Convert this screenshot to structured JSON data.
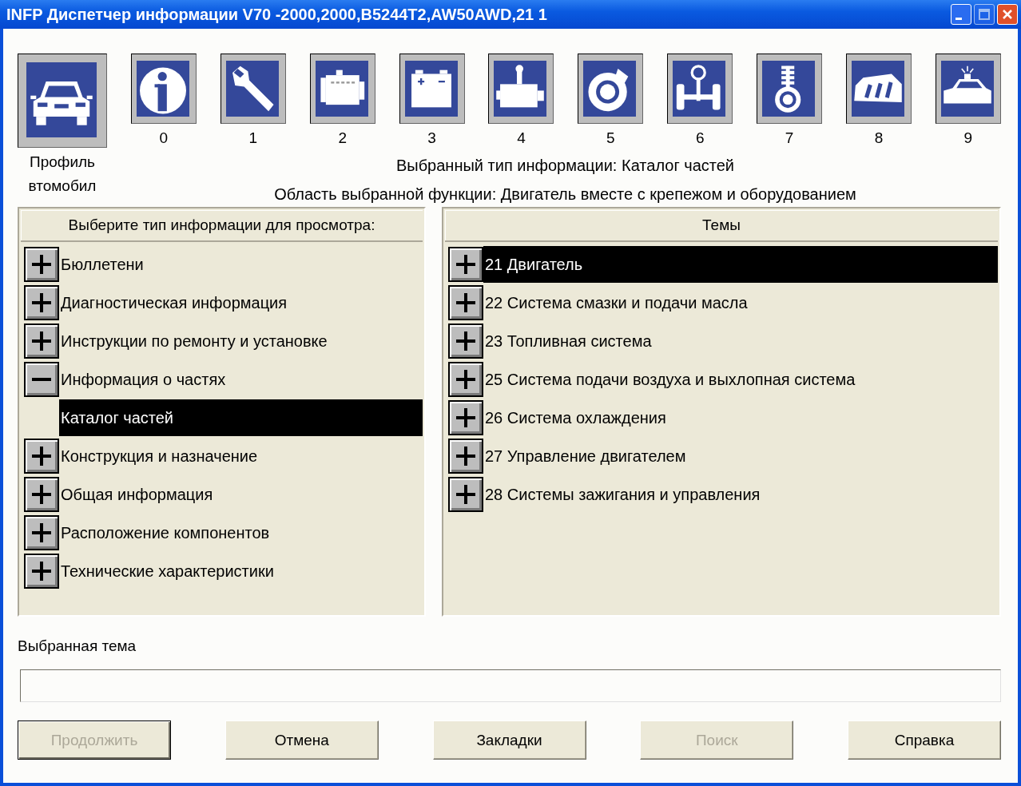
{
  "window": {
    "title": "INFP Диспетчер информации V70 -2000,2000,B5244T2,AW50AWD,21 1"
  },
  "profile": {
    "label_line_1": "Профиль",
    "label_line_2": "втомобил"
  },
  "categories": [
    {
      "label": "0"
    },
    {
      "label": "1"
    },
    {
      "label": "2"
    },
    {
      "label": "3"
    },
    {
      "label": "4"
    },
    {
      "label": "5"
    },
    {
      "label": "6"
    },
    {
      "label": "7"
    },
    {
      "label": "8"
    },
    {
      "label": "9"
    }
  ],
  "selected_info_type": "Выбранный тип информации: Каталог частей",
  "selected_function_area": "Область выбранной функции: Двигатель вместе с крепежом и оборудованием",
  "info_types": {
    "header": "Выберите тип информации для просмотра:",
    "items": [
      {
        "label": "Бюллетени",
        "expanded": false,
        "selected": false
      },
      {
        "label": "Диагностическая информация",
        "expanded": false,
        "selected": false
      },
      {
        "label": "Инструкции по ремонту и установке",
        "expanded": false,
        "selected": false
      },
      {
        "label": "Информация о частях",
        "expanded": true,
        "selected": false,
        "children": [
          {
            "label": "Каталог частей",
            "selected": true
          }
        ]
      },
      {
        "label": "Конструкция и назначение",
        "expanded": false,
        "selected": false
      },
      {
        "label": "Общая информация",
        "expanded": false,
        "selected": false
      },
      {
        "label": "Расположение компонентов",
        "expanded": false,
        "selected": false
      },
      {
        "label": "Технические характеристики",
        "expanded": false,
        "selected": false
      }
    ]
  },
  "topics": {
    "header": "Темы",
    "items": [
      {
        "label": "21 Двигатель",
        "expanded": false,
        "selected": true
      },
      {
        "label": "22 Система смазки и подачи масла",
        "expanded": false,
        "selected": false
      },
      {
        "label": "23 Топливная система",
        "expanded": false,
        "selected": false
      },
      {
        "label": "25 Система подачи воздуха и выхлопная система",
        "expanded": false,
        "selected": false
      },
      {
        "label": "26 Система охлаждения",
        "expanded": false,
        "selected": false
      },
      {
        "label": "27 Управление двигателем",
        "expanded": false,
        "selected": false
      },
      {
        "label": "28 Системы зажигания и управления",
        "expanded": false,
        "selected": false
      }
    ]
  },
  "selected_topic": {
    "label": "Выбранная тема"
  },
  "buttons": [
    {
      "label": "Продолжить",
      "disabled": true
    },
    {
      "label": "Отмена",
      "disabled": false
    },
    {
      "label": "Закладки",
      "disabled": false
    },
    {
      "label": "Поиск",
      "disabled": true
    },
    {
      "label": "Справка",
      "disabled": false
    }
  ]
}
